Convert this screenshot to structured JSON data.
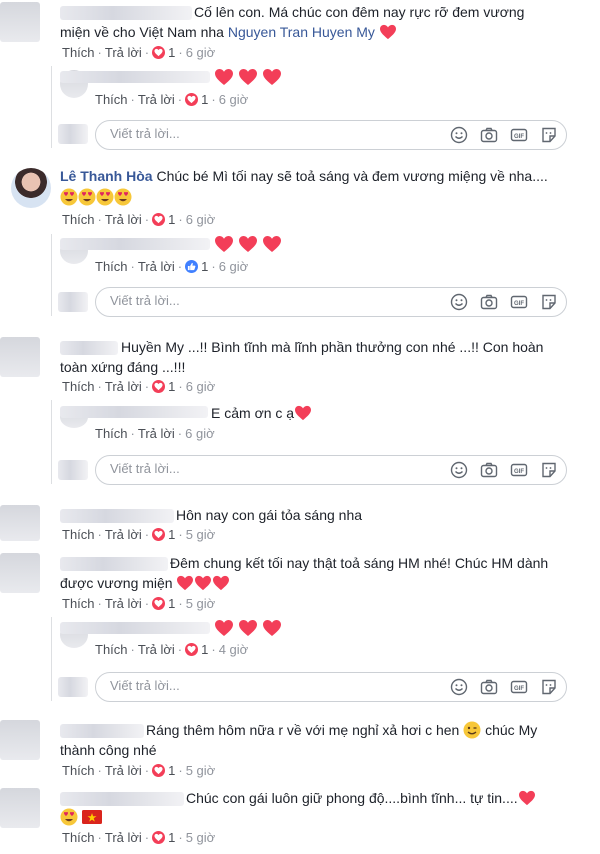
{
  "ui": {
    "like": "Thích",
    "reply": "Trả lời",
    "dot": "·",
    "reply_placeholder": "Viết trả lời..."
  },
  "c1": {
    "text_line1": "Cố lên con. Má chúc con đêm nay rực rỡ đem vương",
    "text_line2": "miện về cho Việt Nam nha",
    "mention": "Nguyen Tran Huyen My",
    "count": "1",
    "time": "6 giờ"
  },
  "c1r1": {
    "count": "1",
    "time": "6 giờ"
  },
  "c2": {
    "name": "Lê Thanh Hòa",
    "text": "Chúc bé Mì tối nay sẽ toả sáng và đem vương miệng về nha....",
    "count": "1",
    "time": "6 giờ"
  },
  "c2r1": {
    "count": "1",
    "time": "6 giờ"
  },
  "c3": {
    "text_line1": "Huyền My ...!! Bình tĩnh mà lĩnh phần thưởng con nhé ...!! Con hoàn",
    "text_line2": "toàn xứng đáng ...!!!",
    "count": "1",
    "time": "6 giờ"
  },
  "c3r1": {
    "text": "E cảm ơn c ạ",
    "time": "6 giờ"
  },
  "c4": {
    "text": "Hôn nay con gái tỏa sáng nha",
    "count": "1",
    "time": "5 giờ"
  },
  "c5": {
    "text_line1": "Đêm chung kết tối nay thật toả sáng HM nhé! Chúc HM dành",
    "text_line2": "được vương miện",
    "count": "1",
    "time": "5 giờ"
  },
  "c5r1": {
    "count": "1",
    "time": "4 giờ"
  },
  "c6": {
    "text_line1": "Ráng thêm hôm nữa r về với mẹ nghỉ xả hơi c hen",
    "text_line1b": "chúc My",
    "text_line2": "thành công nhé",
    "count": "1",
    "time": "5 giờ"
  },
  "c7": {
    "text": "Chúc con gái luôn giữ phong độ....bình tĩnh... tự tin....",
    "count": "1",
    "time": "5 giờ"
  },
  "colors": {
    "link_blue": "#385898",
    "heart_red": "#f33e58",
    "like_blue": "#4080ff",
    "meta_grey": "#90949c"
  },
  "icons": [
    "heart-emoji",
    "heart-eyes-emoji",
    "wink-emoji",
    "vietnam-flag-emoji",
    "smiley-icon",
    "camera-icon",
    "gif-icon",
    "sticker-icon",
    "love-reaction-icon",
    "like-reaction-icon"
  ]
}
